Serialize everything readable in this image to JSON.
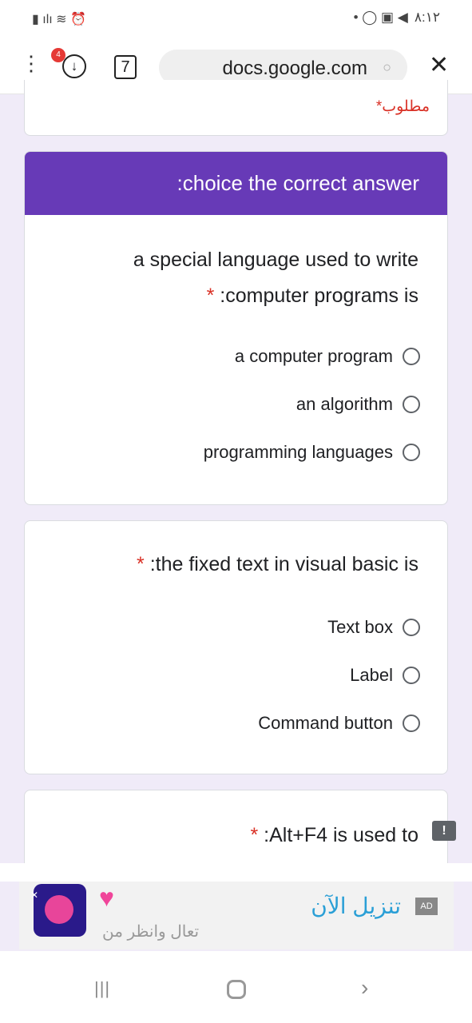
{
  "status_bar": {
    "time": "٨:١٢"
  },
  "browser": {
    "url": "docs.google.com",
    "tab_count": "7",
    "download_badge": "4"
  },
  "form": {
    "required_note": "*مطلوب",
    "section_title": ":choice the correct answer",
    "questions": [
      {
        "title_line1": "a special language used to write",
        "title_line2": ":computer programs is",
        "required_mark": "*",
        "options": [
          "a computer program",
          "an algorithm",
          "programming languages"
        ]
      },
      {
        "title": ":the fixed text in visual basic is",
        "required_mark": "*",
        "options": [
          "Text box",
          "Label",
          "Command button"
        ]
      },
      {
        "title": ":Alt+F4 is used to",
        "required_mark": "*"
      }
    ],
    "accent": "#673ab7"
  },
  "ad": {
    "cta": "تنزيل الآن",
    "subtitle": "تعال وانظر من",
    "badge": "AD"
  }
}
